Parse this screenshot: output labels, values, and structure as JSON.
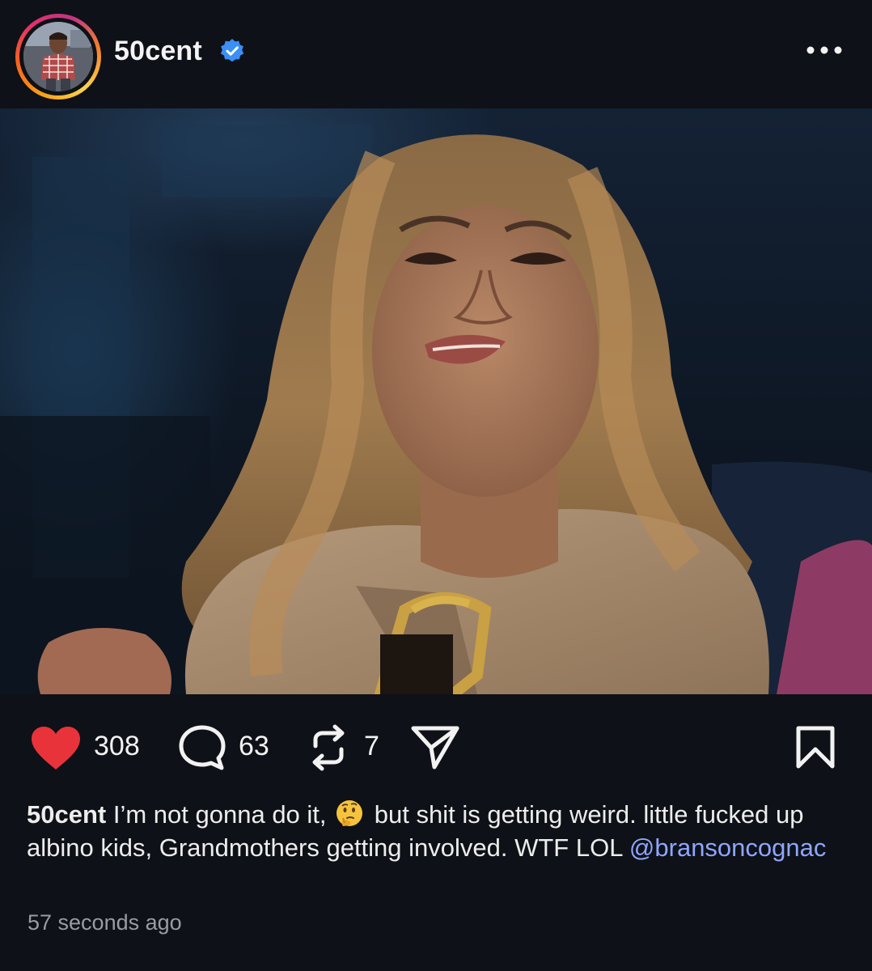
{
  "post": {
    "username": "50cent",
    "verified": true,
    "photo_alt": "",
    "likes": "308",
    "comments": "63",
    "reposts": "7",
    "caption": {
      "username": "50cent",
      "text_before_emoji": "I’m not gonna do it,",
      "emoji": "thinking-face",
      "text_after_emoji": "but shit is getting weird. little fucked up albino kids, Grandmothers getting involved.  WTF LOL",
      "mention": "@bransoncognac"
    },
    "timestamp": "57 seconds ago"
  },
  "icons": {
    "like": "heart-icon",
    "comment": "comment-bubble-icon",
    "repost": "repost-icon",
    "share": "send-icon",
    "save": "bookmark-icon",
    "menu": "more-options-icon",
    "badge": "verified-badge-icon"
  },
  "colors": {
    "background": "#0e1117",
    "like_red": "#e8333b",
    "verified_blue": "#3b8ff6",
    "mention_blue": "#8ea6ff",
    "timestamp_gray": "#9a9ca2"
  }
}
